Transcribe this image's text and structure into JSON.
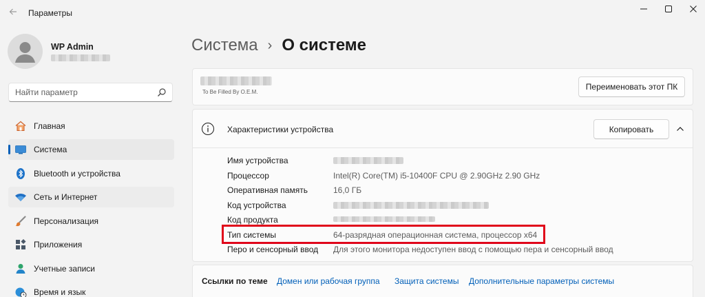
{
  "window": {
    "title": "Параметры",
    "back_icon": "arrow-left-icon",
    "controls": [
      "minimize-icon",
      "maximize-icon",
      "close-icon"
    ]
  },
  "user": {
    "name": "WP Admin",
    "email_redacted": true
  },
  "search": {
    "placeholder": "Найти параметр",
    "icon": "search-icon"
  },
  "sidebar": {
    "items": [
      {
        "label": "Главная",
        "icon": "home-icon"
      },
      {
        "label": "Система",
        "icon": "system-icon",
        "active": true
      },
      {
        "label": "Bluetooth и устройства",
        "icon": "bluetooth-icon"
      },
      {
        "label": "Сеть и Интернет",
        "icon": "wifi-icon"
      },
      {
        "label": "Персонализация",
        "icon": "brush-icon"
      },
      {
        "label": "Приложения",
        "icon": "apps-icon"
      },
      {
        "label": "Учетные записи",
        "icon": "account-icon"
      },
      {
        "label": "Время и язык",
        "icon": "globe-clock-icon"
      }
    ]
  },
  "breadcrumb": {
    "parent": "Система",
    "separator": "›",
    "current": "О системе"
  },
  "pc_card": {
    "oem_text": "To Be Filled By O.E.M.",
    "rename_button": "Переименовать этот ПК"
  },
  "specs": {
    "title": "Характеристики устройства",
    "copy_button": "Копировать",
    "rows": [
      {
        "label": "Имя устройства",
        "value": "",
        "redacted": true
      },
      {
        "label": "Процессор",
        "value": "Intel(R) Core(TM) i5-10400F CPU @ 2.90GHz   2.90 GHz"
      },
      {
        "label": "Оперативная память",
        "value": "16,0 ГБ"
      },
      {
        "label": "Код устройства",
        "value": "",
        "redacted": true
      },
      {
        "label": "Код продукта",
        "value": "",
        "redacted": true
      },
      {
        "label": "Тип системы",
        "value": "64-разрядная операционная система, процессор x64",
        "highlighted": true
      },
      {
        "label": "Перо и сенсорный ввод",
        "value": "Для этого монитора недоступен ввод с помощью пера и сенсорный ввод"
      }
    ]
  },
  "links": {
    "title": "Ссылки по теме",
    "items": [
      "Домен или рабочая группа",
      "Защита системы",
      "Дополнительные параметры системы"
    ]
  },
  "colors": {
    "accent": "#005fb8",
    "highlight": "#e0051a",
    "background": "#f3f3f3"
  }
}
